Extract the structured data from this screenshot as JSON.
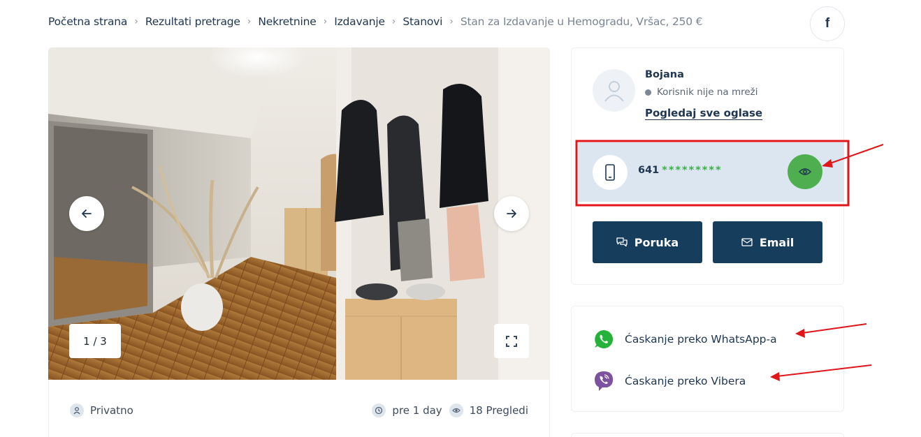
{
  "breadcrumb": [
    {
      "label": "Početna strana"
    },
    {
      "label": "Rezultati pretrage"
    },
    {
      "label": "Nekretnine"
    },
    {
      "label": "Izdavanje"
    },
    {
      "label": "Stanovi"
    },
    {
      "label": "Stan za Izdavanje u Hemogradu, Vršac, 250 €"
    }
  ],
  "breadcrumb_separator": "›",
  "share": {
    "icon": "facebook-icon",
    "label": "f"
  },
  "gallery": {
    "counter": "1 / 3",
    "prev_icon": "arrow-left-icon",
    "next_icon": "arrow-right-icon",
    "fullscreen_icon": "expand-icon"
  },
  "meta": {
    "seller_type": "Privatno",
    "posted": "pre 1 day",
    "views": "18 Pregledi"
  },
  "seller": {
    "name": "Bojana",
    "status": "Korisnik nije na mreži",
    "all_ads_link": "Pogledaj sve oglase",
    "phone_prefix": "641",
    "phone_mask": "*********"
  },
  "actions": {
    "message_label": "Poruka",
    "email_label": "Email"
  },
  "chat": {
    "whatsapp_label": "Ćaskanje preko WhatsApp-a",
    "viber_label": "Ćaskanje preko Vibera"
  },
  "colors": {
    "primary": "#173d5c",
    "reveal_green": "#4fae4f",
    "phone_box": "#dce6f0",
    "annotation_red": "#e0161b",
    "whatsapp": "#25b23a",
    "viber": "#7d529e"
  }
}
